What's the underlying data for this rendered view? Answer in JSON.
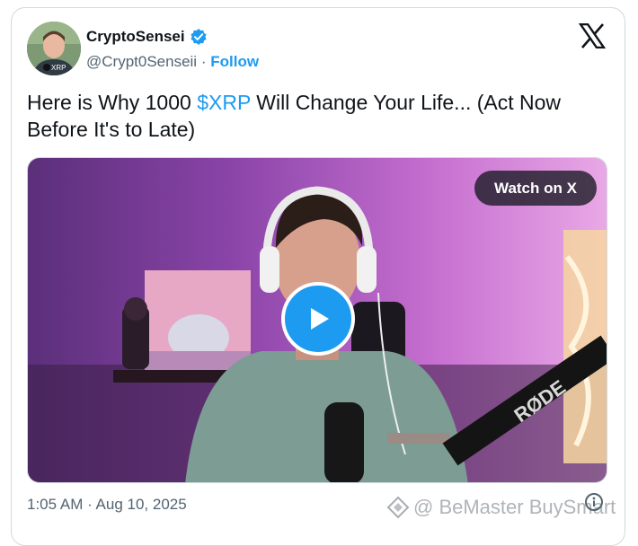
{
  "author": {
    "display_name": "CryptoSensei",
    "handle": "@Crypt0Senseii",
    "separator": "·",
    "follow_label": "Follow",
    "avatar_shirt_text": "XRP"
  },
  "tweet": {
    "text_before": "Here is Why 1000 ",
    "cashtag": "$XRP",
    "text_after": " Will Change Your Life... (Act Now Before It's to Late)",
    "timestamp": "1:05 AM · Aug 10, 2025"
  },
  "media": {
    "watch_label": "Watch on X",
    "mic_brand": "RØDE"
  },
  "watermark": {
    "text": "@ BeMaster BuySmart"
  },
  "colors": {
    "accent": "#1d9bf0",
    "text": "#0f1419",
    "muted": "#536471"
  }
}
